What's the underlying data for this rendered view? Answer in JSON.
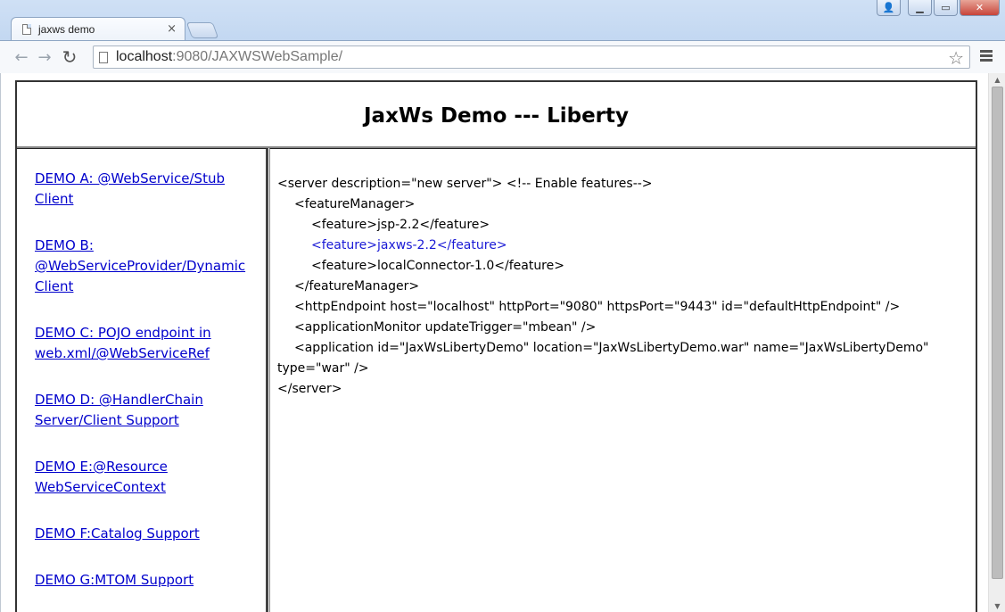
{
  "browser": {
    "tab_title": "jaxws demo",
    "tab_close": "×",
    "url_host": "localhost",
    "url_rest": ":9080/JAXWSWebSample/",
    "window_controls": {
      "user": "👤",
      "minimize": "▁",
      "maximize": "▭",
      "close": "✕"
    },
    "nav": {
      "back": "←",
      "forward": "→",
      "reload": "↻"
    },
    "star": "☆"
  },
  "page": {
    "title": "JaxWs Demo --- Liberty",
    "demos": [
      {
        "label": "DEMO A: @WebService/Stub Client"
      },
      {
        "label": "DEMO B: @WebServiceProvider/Dynamic Client"
      },
      {
        "label": "DEMO C: POJO endpoint in web.xml/@WebServiceRef"
      },
      {
        "label": "DEMO D: @HandlerChain Server/Client Support"
      },
      {
        "label": "DEMO E:@Resource WebServiceContext"
      },
      {
        "label": "DEMO F:Catalog Support"
      },
      {
        "label": "DEMO G:MTOM Support"
      }
    ],
    "xml_lines": [
      {
        "indent": 0,
        "text": "<server description=\"new server\"> <!-- Enable features-->",
        "highlight": false
      },
      {
        "indent": 1,
        "text": "<featureManager>",
        "highlight": false
      },
      {
        "indent": 2,
        "text": "<feature>jsp-2.2</feature>",
        "highlight": false
      },
      {
        "indent": 2,
        "text": "<feature>jaxws-2.2</feature>",
        "highlight": true
      },
      {
        "indent": 2,
        "text": "<feature>localConnector-1.0</feature>",
        "highlight": false
      },
      {
        "indent": 1,
        "text": "</featureManager>",
        "highlight": false
      },
      {
        "indent": 1,
        "text": "<httpEndpoint host=\"localhost\" httpPort=\"9080\" httpsPort=\"9443\" id=\"defaultHttpEndpoint\" />",
        "highlight": false
      },
      {
        "indent": 1,
        "text": "<applicationMonitor updateTrigger=\"mbean\" />",
        "highlight": false
      },
      {
        "indent": 1,
        "text": "<application id=\"JaxWsLibertyDemo\" location=\"JaxWsLibertyDemo.war\" name=\"JaxWsLibertyDemo\"",
        "highlight": false
      },
      {
        "indent": 0,
        "text": "type=\"war\" />",
        "highlight": false
      },
      {
        "indent": 0,
        "text": "</server>",
        "highlight": false
      }
    ]
  },
  "colors": {
    "link": "#0000cc",
    "highlight_xml": "#1a1ad6",
    "chrome": "#cfe0f5"
  }
}
